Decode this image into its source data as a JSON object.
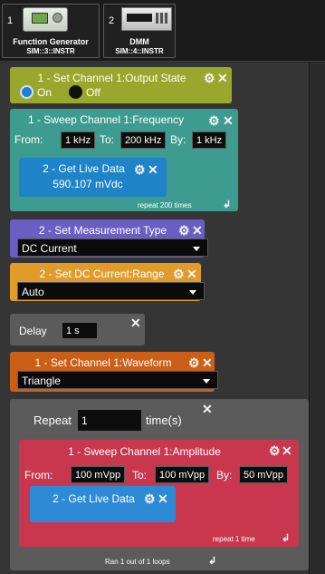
{
  "instruments": [
    {
      "index": "1",
      "name": "Function Generator",
      "address": "SIM::3::INSTR",
      "icon": "function-generator-icon"
    },
    {
      "index": "2",
      "name": "DMM",
      "address": "SIM::4::INSTR",
      "icon": "dmm-icon"
    }
  ],
  "blocks": {
    "output_state": {
      "title": "1 - Set Channel 1:Output State",
      "on_label": "On",
      "off_label": "Off",
      "selected": "On"
    },
    "sweep_freq": {
      "title": "1 - Sweep Channel 1:Frequency",
      "from_label": "From:",
      "from_value": "1 kHz",
      "to_label": "To:",
      "to_value": "200 kHz",
      "by_label": "By:",
      "by_value": "1 kHz",
      "repeat_text": "repeat 200 times"
    },
    "live_data_1": {
      "title": "2 - Get Live Data",
      "value": "590.107 mVdc"
    },
    "measure_type": {
      "title": "2 - Set Measurement Type",
      "selected": "DC Current"
    },
    "dc_range": {
      "title": "2 - Set DC Current:Range",
      "selected": "Auto"
    },
    "delay": {
      "label": "Delay",
      "value": "1 s"
    },
    "waveform": {
      "title": "1 - Set Channel 1:Waveform",
      "selected": "Triangle"
    },
    "repeat": {
      "label": "Repeat",
      "value": "1",
      "unit": "time(s)",
      "footer": "Ran 1 out of 1 loops"
    },
    "sweep_amp": {
      "title": "1 - Sweep Channel 1:Amplitude",
      "from_label": "From:",
      "from_value": "100 mVpp",
      "to_label": "To:",
      "to_value": "100 mVpp",
      "by_label": "By:",
      "by_value": "50 mVpp",
      "repeat_text": "repeat 1 time"
    },
    "live_data_2": {
      "title": "2 - Get Live Data"
    }
  },
  "icons": {
    "gear": "⚙",
    "close": "✕",
    "loop": "↲"
  },
  "colors": {
    "output_state": "#9aa72d",
    "sweep_freq": "#3e9b8f",
    "live_data": "#1e83c7",
    "measure_type": "#6b5ec3",
    "dc_range": "#e09b2b",
    "delay": "#5b5b5b",
    "waveform": "#cb5f18",
    "repeat": "#5b5b5b",
    "sweep_amp": "#c9374e"
  }
}
